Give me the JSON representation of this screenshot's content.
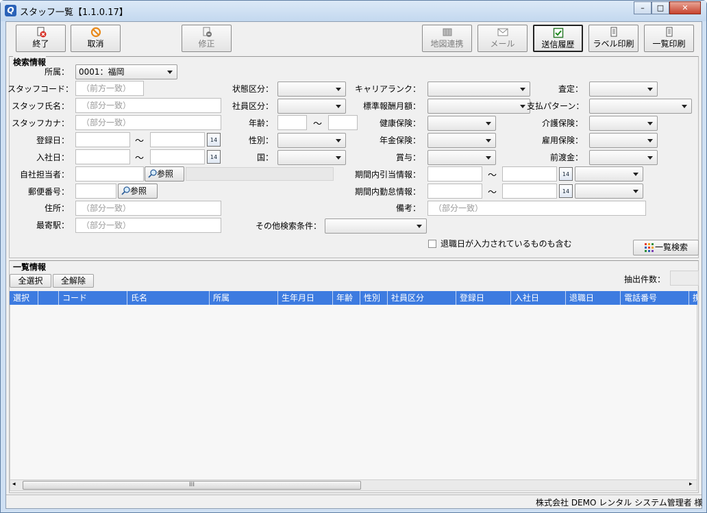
{
  "window": {
    "title": "スタッフ一覧【1.1.0.17】",
    "minimize": "–",
    "maximize": "□",
    "close": "✕"
  },
  "toolbar": {
    "exit": "終了",
    "cancel": "取消",
    "edit": "修正",
    "map": "地図連携",
    "mail": "メール",
    "history": "送信履歴",
    "label_print": "ラベル印刷",
    "list_print": "一覧印刷"
  },
  "search": {
    "section_title": "検索情報",
    "affiliation_label": "所属：",
    "affiliation_value": "0001：福岡",
    "staff_code_label": "スタッフコード：",
    "staff_code_ph": "（前方一致）",
    "staff_name_label": "スタッフ氏名：",
    "staff_name_ph": "（部分一致）",
    "staff_kana_label": "スタッフカナ：",
    "staff_kana_ph": "（部分一致）",
    "reg_date_label": "登録日：",
    "join_date_label": "入社日：",
    "own_manager_label": "自社担当者：",
    "ref_label": "参照",
    "postal_label": "郵便番号：",
    "address_label": "住所：",
    "address_ph": "（部分一致）",
    "station_label": "最寄駅：",
    "station_ph": "（部分一致）",
    "status_label": "状態区分：",
    "employee_label": "社員区分：",
    "age_label": "年齢：",
    "gender_label": "性別：",
    "country_label": "国：",
    "other_label": "その他検索条件：",
    "career_label": "キャリアランク：",
    "std_pay_label": "標準報酬月額：",
    "health_label": "健康保険：",
    "pension_label": "年金保険：",
    "bonus_label": "賞与：",
    "period_alloc_label": "期間内引当情報：",
    "period_attend_label": "期間内勤怠情報：",
    "remarks_label": "備考：",
    "remarks_ph": "（部分一致）",
    "assess_label": "査定：",
    "payment_label": "支払パターン：",
    "care_label": "介護保険：",
    "employment_label": "雇用保険：",
    "advance_label": "前渡金：",
    "tilde": "～",
    "include_retired": "退職日が入力されているものも含む",
    "search_button": "一覧検索",
    "cal_icon": "14"
  },
  "list": {
    "section_title": "一覧情報",
    "select_all": "全選択",
    "deselect_all": "全解除",
    "count_label": "抽出件数：",
    "columns": [
      "選択",
      "",
      "コード",
      "氏名",
      "所属",
      "生年月日",
      "年齢",
      "性別",
      "社員区分",
      "登録日",
      "入社日",
      "退職日",
      "電話番号",
      "携"
    ],
    "scroll_grip": "III"
  },
  "status": {
    "user": "株式会社 DEMO レンタル  システム管理者 様"
  },
  "colors": {
    "grid_header": "#3d7be0",
    "title_bar": "#cfe0f3"
  }
}
